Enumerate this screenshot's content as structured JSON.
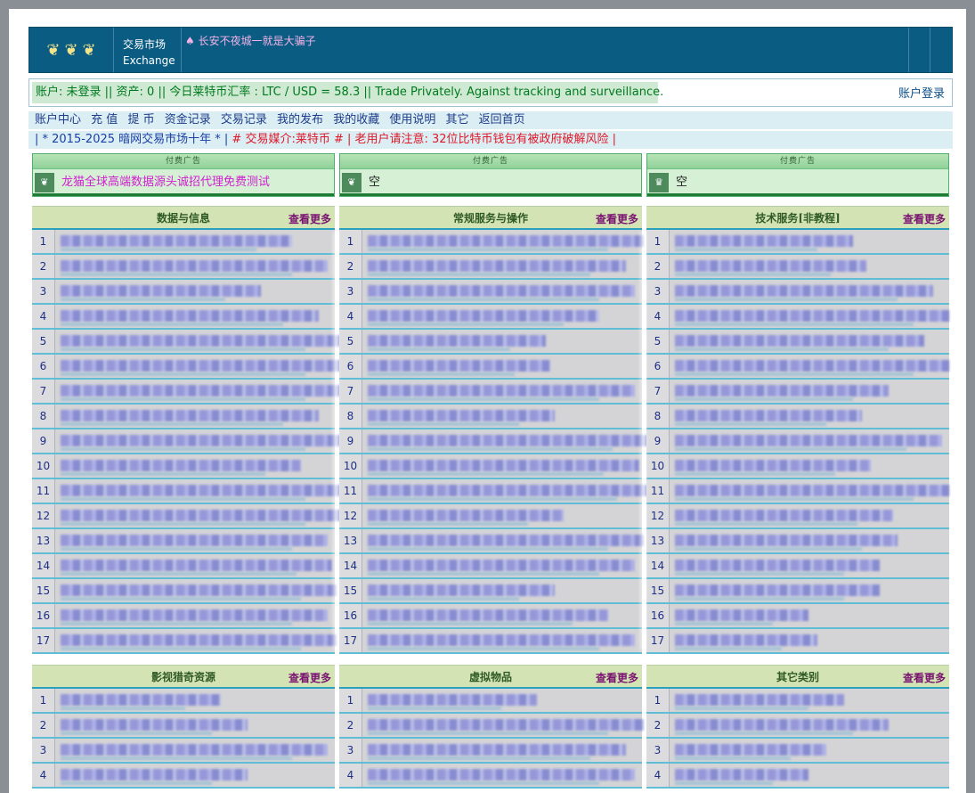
{
  "header": {
    "logo_glyphs": [
      "❦",
      "❦",
      "❦"
    ],
    "brand_cn": "交易市场",
    "brand_en": "Exchange",
    "marquee": "♠ 长安不夜城一就是大骗子"
  },
  "status": {
    "text": "账户: 未登录 || 资产: 0 || 今日莱特币汇率 : LTC / USD = 58.3 || Trade Privately. Against tracking and surveillance.",
    "login": "账户登录"
  },
  "nav": {
    "items": [
      "账户中心",
      "充 值",
      "提 币",
      "资金记录",
      "交易记录",
      "我的发布",
      "我的收藏",
      "使用说明",
      "其它",
      "返回首页"
    ]
  },
  "notice": {
    "part1": "| * 2015-2025 暗网交易市场十年 * |",
    "part2": " # 交易媒介:莱特币 # |",
    "part3": " 老用户请注意: 32位比特币钱包有被政府破解风险 |"
  },
  "ads": [
    {
      "head": "付费广告",
      "text": "龙猫全球高端数据源头诚招代理免费测试",
      "icon": "❦",
      "color": "#d01fd0"
    },
    {
      "head": "付费广告",
      "text": "空",
      "icon": "❦",
      "color": "#222222"
    },
    {
      "head": "付费广告",
      "text": "空",
      "icon": "♛",
      "color": "#222222"
    }
  ],
  "panels": [
    {
      "title": "数据与信息",
      "more": "查看更多"
    },
    {
      "title": "常规服务与操作",
      "more": "查看更多"
    },
    {
      "title": "技术服务[非教程]",
      "more": "查看更多"
    },
    {
      "title": "影视猎奇资源",
      "more": "查看更多"
    },
    {
      "title": "虚拟物品",
      "more": "查看更多"
    },
    {
      "title": "其它类别",
      "more": "查看更多"
    }
  ],
  "row_numbers_top": [
    "1",
    "2",
    "3",
    "4",
    "5",
    "6",
    "7",
    "8",
    "9",
    "10",
    "11",
    "12",
    "13",
    "14",
    "15",
    "16",
    "17"
  ],
  "row_numbers_bottom": [
    "1",
    "2",
    "3",
    "4"
  ],
  "colors": {
    "header_bg": "#0b5c83",
    "status_text": "#007a1f",
    "nav_text": "#1d3b8a",
    "notice_red": "#e0182a",
    "panel_more": "#7a1470"
  }
}
